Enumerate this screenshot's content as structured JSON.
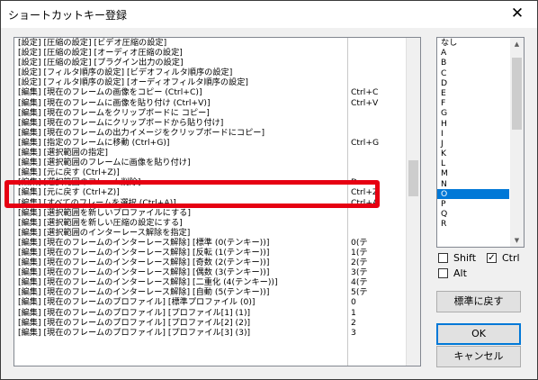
{
  "window": {
    "title": "ショートカットキー登録",
    "close_glyph": "✕"
  },
  "shortcut_list": {
    "rows": [
      {
        "command": "[設定] [圧縮の設定] [ビデオ圧縮の設定]",
        "key": ""
      },
      {
        "command": "[設定] [圧縮の設定] [オーディオ圧縮の設定]",
        "key": ""
      },
      {
        "command": "[設定] [圧縮の設定] [プラグイン出力の設定]",
        "key": ""
      },
      {
        "command": "[設定] [フィルタ順序の設定] [ビデオフィルタ順序の設定]",
        "key": ""
      },
      {
        "command": "[設定] [フィルタ順序の設定] [オーディオフィルタ順序の設定]",
        "key": ""
      },
      {
        "command": "[編集] [現在のフレームの画像をコピー (Ctrl+C)]",
        "key": "Ctrl+C"
      },
      {
        "command": "[編集] [現在のフレームに画像を貼り付け (Ctrl+V)]",
        "key": "Ctrl+V"
      },
      {
        "command": "[編集] [現在のフレームをクリップボードに コピー]",
        "key": ""
      },
      {
        "command": "[編集] [現在のフレームにクリップボードから貼り付け]",
        "key": ""
      },
      {
        "command": "[編集] [現在のフレームの出力イメージをクリップボードにコピー]",
        "key": ""
      },
      {
        "command": "[編集] [指定のフレームに移動 (Ctrl+G)]",
        "key": "Ctrl+G"
      },
      {
        "command": "[編集] [選択範囲の指定]",
        "key": ""
      },
      {
        "command": "[編集] [選択範囲のフレームに画像を貼り付け]",
        "key": ""
      },
      {
        "command": "[編集] [元に戻す (Ctrl+Z)]",
        "key": ""
      },
      {
        "command": "[編集] [選択範囲のフレーム削除]",
        "key": "D"
      },
      {
        "command": "[編集] [元に戻す (Ctrl+Z)]",
        "key": "Ctrl+Z"
      },
      {
        "command": "[編集] [すべてのフレームを選択 (Ctrl+A)]",
        "key": "Ctrl+A"
      },
      {
        "command": "[編集] [選択範囲を新しいプロファイルにする]",
        "key": ""
      },
      {
        "command": "[編集] [選択範囲を新しい圧縮の設定にする]",
        "key": ""
      },
      {
        "command": "[編集] [選択範囲のインターレース解除を指定]",
        "key": ""
      },
      {
        "command": "[編集] [現在のフレームのインターレース解除] [標準 (0(テンキー))]",
        "key": "0(テ"
      },
      {
        "command": "[編集] [現在のフレームのインターレース解除] [反転 (1(テンキー))]",
        "key": "1(テ"
      },
      {
        "command": "[編集] [現在のフレームのインターレース解除] [奇数 (2(テンキー))]",
        "key": "2(テ"
      },
      {
        "command": "[編集] [現在のフレームのインターレース解除] [偶数 (3(テンキー))]",
        "key": "3(テ"
      },
      {
        "command": "[編集] [現在のフレームのインターレース解除] [二重化 (4(テンキー))]",
        "key": "4(テ"
      },
      {
        "command": "[編集] [現在のフレームのインターレース解除] [自動 (5(テンキー))]",
        "key": "5(テ"
      },
      {
        "command": "[編集] [現在のフレームのプロファイル] [標準プロファイル (0)]",
        "key": "0"
      },
      {
        "command": "[編集] [現在のフレームのプロファイル] [プロファイル[1] (1)]",
        "key": "1"
      },
      {
        "command": "[編集] [現在のフレームのプロファイル] [プロファイル[2] (2)]",
        "key": "2"
      },
      {
        "command": "[編集] [現在のフレームのプロファイル] [プロファイル[3] (3)]",
        "key": "3"
      }
    ],
    "scroll_position_fraction": 0.42
  },
  "key_list": {
    "items": [
      "なし",
      "A",
      "B",
      "C",
      "D",
      "E",
      "F",
      "G",
      "H",
      "I",
      "J",
      "K",
      "L",
      "M",
      "N",
      "O",
      "P",
      "Q",
      "R"
    ],
    "selected": "O",
    "scroll_up_glyph": "▲",
    "scroll_down_glyph": "▼"
  },
  "modifiers": {
    "shift": {
      "label": "Shift",
      "checked": false
    },
    "ctrl": {
      "label": "Ctrl",
      "checked": true
    },
    "alt": {
      "label": "Alt",
      "checked": false
    },
    "check_glyph": "✓"
  },
  "buttons": {
    "reset": "標準に戻す",
    "ok": "OK",
    "cancel": "キャンセル"
  },
  "colors": {
    "highlight_border": "#e60012",
    "selection": "#0078d7"
  }
}
